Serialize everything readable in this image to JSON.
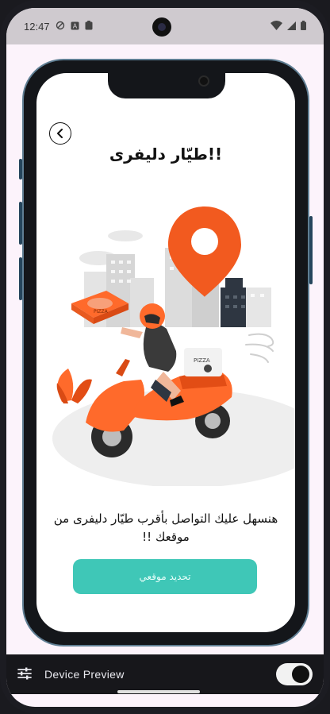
{
  "status_bar": {
    "time": "12:47",
    "left_icons": [
      "dnd-icon",
      "autofill-icon",
      "clipboard-icon"
    ],
    "right_icons": [
      "wifi-icon",
      "signal-icon",
      "battery-icon"
    ]
  },
  "app": {
    "title": "!!طيّار دليفرى",
    "description": "هنسهل عليك التواصل بأقرب طيّار دليفرى من موقعك !!",
    "cta_label": "تحديد موقعي",
    "illustration": "delivery-scooter-pizza-location-pin",
    "colors": {
      "accent": "#3fc7b7",
      "pin": "#f25a1f",
      "scooter": "#ff6a2b"
    }
  },
  "preview_bar": {
    "label": "Device Preview",
    "toggle_on": true
  }
}
